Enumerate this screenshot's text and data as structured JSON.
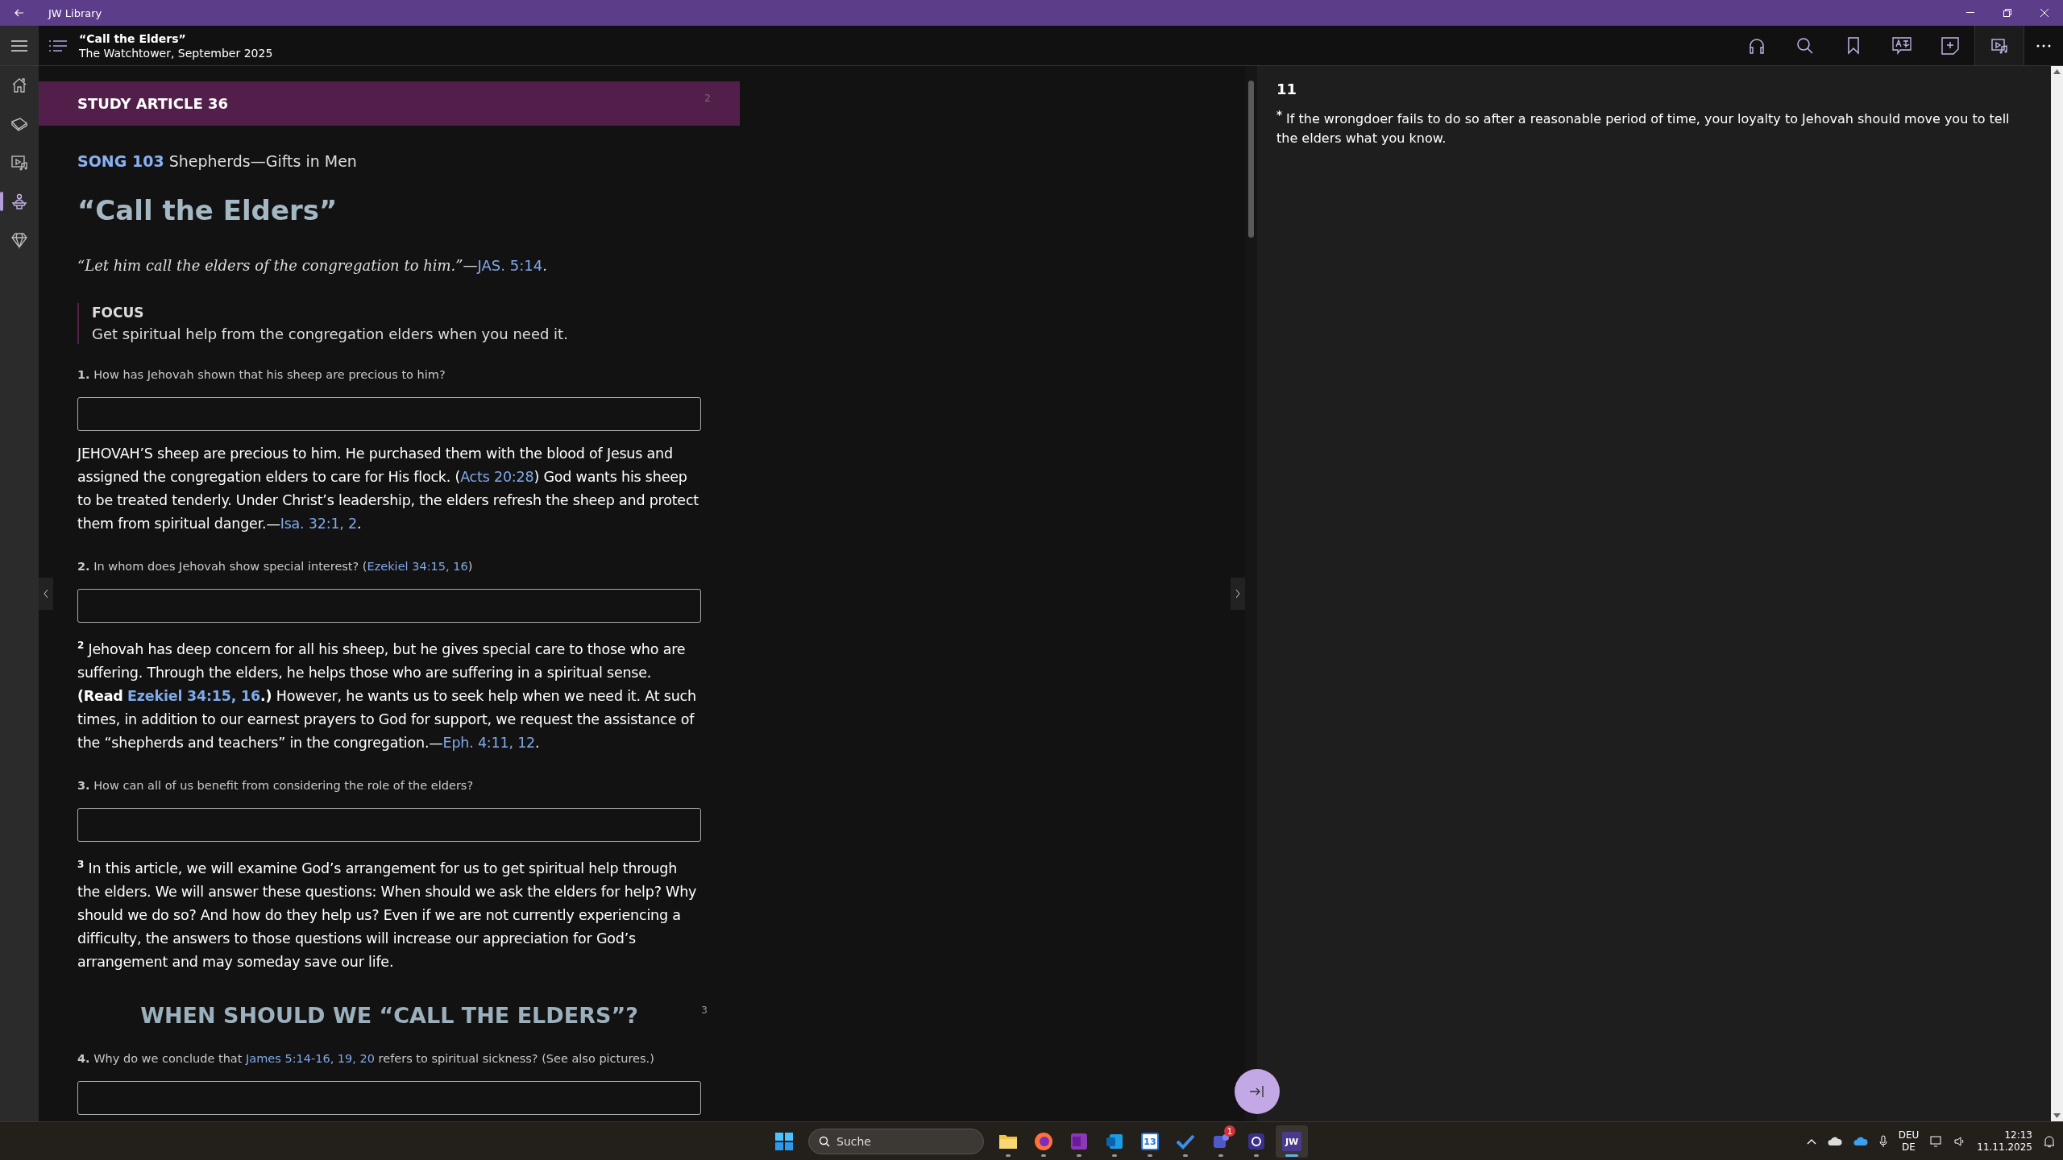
{
  "window": {
    "title": "JW Library"
  },
  "header": {
    "title": "“Call the Elders”",
    "subtitle": "The Watchtower, September 2025"
  },
  "sidebar": {
    "items": [
      {
        "kind": "home",
        "selected": false
      },
      {
        "kind": "library",
        "selected": false
      },
      {
        "kind": "media",
        "selected": false
      },
      {
        "kind": "meetings",
        "selected": true
      },
      {
        "kind": "gems",
        "selected": false
      }
    ]
  },
  "article": {
    "banner": {
      "label": "STUDY ARTICLE 36",
      "page": "2"
    },
    "song": {
      "number": "SONG 103",
      "title": "Shepherds—Gifts in Men"
    },
    "title": "“Call the Elders”",
    "theme": {
      "quote": "“Let him call the elders of the congregation to him.”—",
      "ref": "JAS. 5:14",
      "end": "."
    },
    "focus": {
      "label": "FOCUS",
      "text": "Get spiritual help from the congregation elders when you need it."
    },
    "blocks": [
      {
        "kind": "question",
        "number": "1.",
        "parts": [
          {
            "kind": "text",
            "text": "How has Jehovah shown that his sheep are precious to him?"
          }
        ]
      },
      {
        "kind": "answer_box"
      },
      {
        "kind": "paragraph",
        "parts": [
          {
            "kind": "text",
            "text": "JEHOVAH’S sheep are precious to him. He purchased them with the blood of Jesus and assigned the congregation elders to care for His flock. ("
          },
          {
            "kind": "link",
            "text": "Acts 20:28"
          },
          {
            "kind": "text",
            "text": ") God wants his sheep to be treated tenderly. Under Christ’s leadership, the elders refresh the sheep and protect them from spiritual danger.—"
          },
          {
            "kind": "link",
            "text": "Isa. 32:1, 2"
          },
          {
            "kind": "text",
            "text": "."
          }
        ]
      },
      {
        "kind": "question",
        "number": "2.",
        "parts": [
          {
            "kind": "text",
            "text": "In whom does Jehovah show special interest? ("
          },
          {
            "kind": "link",
            "text": "Ezekiel 34:15, 16"
          },
          {
            "kind": "text",
            "text": ")"
          }
        ]
      },
      {
        "kind": "answer_box"
      },
      {
        "kind": "paragraph",
        "number": "2",
        "parts": [
          {
            "kind": "text",
            "text": "Jehovah has deep concern for all his sheep, but he gives special care to those who are suffering. Through the elders, he helps those who are suffering in a spiritual sense. **(Read** "
          },
          {
            "kind": "link",
            "text": "**Ezekiel 34:15, 16**"
          },
          {
            "kind": "text",
            "text": "**.)** However, he wants us to seek help when we need it. At such times, in addition to our earnest prayers to God for support, we request the assistance of the “shepherds and teachers” in the congregation.—"
          },
          {
            "kind": "link",
            "text": "Eph. 4:11, 12"
          },
          {
            "kind": "text",
            "text": "."
          }
        ]
      },
      {
        "kind": "question",
        "number": "3.",
        "parts": [
          {
            "kind": "text",
            "text": "How can all of us benefit from considering the role of the elders?"
          }
        ]
      },
      {
        "kind": "answer_box"
      },
      {
        "kind": "paragraph",
        "number": "3",
        "parts": [
          {
            "kind": "text",
            "text": "In this article, we will examine God’s arrangement for us to get spiritual help through the elders. We will answer these questions: When should we ask the elders for help? Why should we do so? And how do they help us? Even if we are not currently experiencing a difficulty, the answers to those questions will increase our appreciation for God’s arrangement and may someday save our life."
          }
        ]
      },
      {
        "kind": "heading",
        "text": "WHEN SHOULD WE “CALL THE ELDERS”?",
        "page": "3"
      },
      {
        "kind": "question",
        "number": "4.",
        "parts": [
          {
            "kind": "text",
            "text": "Why do we conclude that "
          },
          {
            "kind": "link",
            "text": "James 5:14-16, 19, 20"
          },
          {
            "kind": "text",
            "text": " refers to spiritual sickness? (See also pictures.)"
          }
        ]
      },
      {
        "kind": "answer_box"
      }
    ]
  },
  "footnote_pane": {
    "paragraph": "11",
    "mark": "*",
    "text": "If the wrongdoer fails to do so after a reasonable period of time, your loyalty to Jehovah should move you to tell the elders what you know."
  },
  "taskbar": {
    "search": {
      "placeholder": "Suche"
    },
    "apps": [
      {
        "kind": "folder",
        "selected": false
      },
      {
        "kind": "browser",
        "selected": false
      },
      {
        "kind": "notes",
        "selected": false
      },
      {
        "kind": "mail",
        "selected": false
      },
      {
        "kind": "calendar",
        "label": "13",
        "selected": false
      },
      {
        "kind": "todo",
        "selected": false
      },
      {
        "kind": "teams",
        "badge": "1",
        "selected": false
      },
      {
        "kind": "tool",
        "selected": false
      },
      {
        "kind": "jw",
        "label": "JW",
        "selected": true
      }
    ],
    "language": "DEU",
    "layout": "DE",
    "time": "12:13",
    "date": "11.11.2025"
  }
}
